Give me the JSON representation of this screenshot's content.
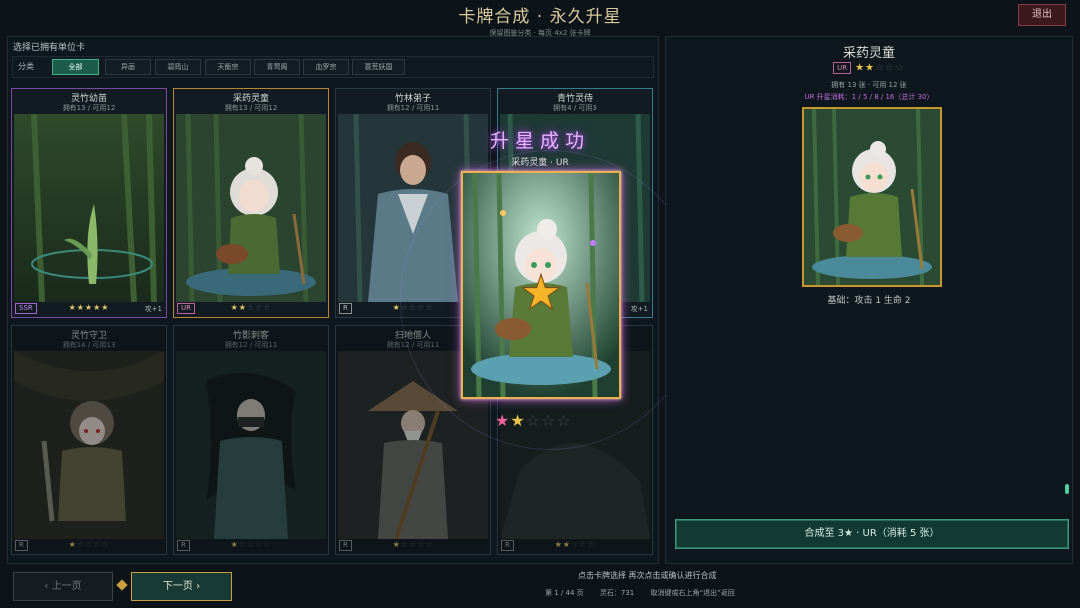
{
  "header": {
    "title": "卡牌合成 · 永久升星",
    "subtitle": "保留图鉴分类 · 每页 4x2 张卡牌",
    "exit_label": "退出"
  },
  "left_panel": {
    "heading": "选择已拥有单位卡",
    "filter_label": "分类",
    "filters": [
      "全部",
      "异画",
      "碧筠山",
      "天衡宗",
      "青莺阁",
      "血罗宗",
      "蓑荒妖国"
    ],
    "active_filter": "全部"
  },
  "cards": [
    {
      "name": "灵竹幼苗",
      "count": "拥有13 / 可用12",
      "rarity": "SSR",
      "stars_filled": "★★★★★",
      "stars_empty": "",
      "bonus": "攻+1"
    },
    {
      "name": "采药灵童",
      "count": "拥有13 / 可用12",
      "rarity": "UR",
      "stars_filled": "★★",
      "stars_empty": "☆☆☆",
      "bonus": ""
    },
    {
      "name": "竹林弟子",
      "count": "拥有12 / 可用11",
      "rarity": "R",
      "stars_filled": "★",
      "stars_empty": "☆☆☆☆",
      "bonus": ""
    },
    {
      "name": "青竹灵侍",
      "count": "拥有4 / 可用3",
      "rarity": "",
      "stars_filled": "",
      "stars_empty": "",
      "bonus": "攻+1"
    },
    {
      "name": "灵竹守卫",
      "count": "拥有14 / 可用13",
      "rarity": "R",
      "stars_filled": "★",
      "stars_empty": "☆☆☆☆",
      "bonus": ""
    },
    {
      "name": "竹影刺客",
      "count": "拥有12 / 可用11",
      "rarity": "R",
      "stars_filled": "★",
      "stars_empty": "☆☆☆☆",
      "bonus": ""
    },
    {
      "name": "扫地僧人",
      "count": "拥有12 / 可用11",
      "rarity": "R",
      "stars_filled": "★",
      "stars_empty": "☆☆☆☆",
      "bonus": ""
    },
    {
      "name": "",
      "count": "",
      "rarity": "R",
      "stars_filled": "★★",
      "stars_empty": "☆☆☆",
      "bonus": ""
    }
  ],
  "overlay": {
    "title": "升星成功",
    "subtitle": "采药灵童 · UR",
    "stars_pink": "★",
    "stars_gold": "★",
    "stars_empty": "☆☆☆"
  },
  "detail": {
    "name": "采药灵童",
    "rarity": "UR",
    "stars_filled": "★★",
    "stars_empty": "☆☆☆",
    "owned": "拥有 13 张 · 可用 12 张",
    "cost": "UR 升星消耗：1 / 5 / 8 / 16（总计 30）",
    "base_stats": "基础：攻击 1  生命 2",
    "merge_button": "合成至 3★ · UR（消耗 5 张）"
  },
  "footer": {
    "prev_label": "‹  上一页",
    "next_label": "下一页  ›",
    "hint_line1": "点击卡牌选择  再次点击或确认进行合成",
    "page_info": "第 1 / 44 页",
    "stone_info": "灵石：731",
    "exit_hint": "取消键或右上角“退出”返回"
  },
  "colors": {
    "accent_teal": "#3fae8a",
    "gold_frame": "#f0b24a",
    "ur_pink": "#e488c0",
    "ssr_purple": "#c58af0"
  }
}
